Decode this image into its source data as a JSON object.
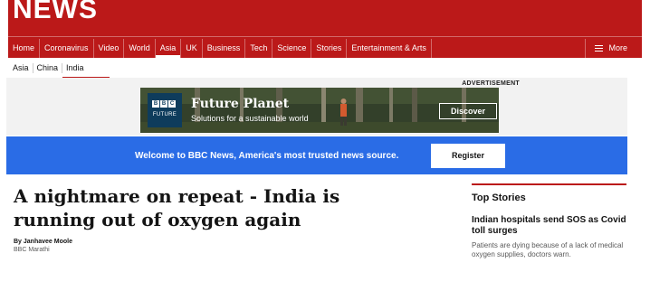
{
  "header": {
    "logo": "NEWS",
    "nav": [
      "Home",
      "Coronavirus",
      "Video",
      "World",
      "Asia",
      "UK",
      "Business",
      "Tech",
      "Science",
      "Stories",
      "Entertainment & Arts"
    ],
    "active_nav": "Asia",
    "more_label": "More"
  },
  "subnav": {
    "items": [
      "Asia",
      "China",
      "India"
    ],
    "active": "India"
  },
  "ad": {
    "label": "ADVERTISEMENT",
    "logo_letters": [
      "B",
      "B",
      "C"
    ],
    "logo_word": "FUTURE",
    "title": "Future Planet",
    "subtitle": "Solutions for a sustainable world",
    "button": "Discover"
  },
  "banner": {
    "text": "Welcome to BBC News, America's most trusted news source.",
    "button": "Register"
  },
  "article": {
    "headline": "A nightmare on repeat - India is running out of oxygen again",
    "byline": "By Janhavee Moole",
    "org": "BBC Marathi"
  },
  "top_stories": {
    "heading": "Top Stories",
    "items": [
      {
        "title": "Indian hospitals send SOS as Covid toll surges",
        "summary": "Patients are dying because of a lack of medical oxygen supplies, doctors warn."
      }
    ]
  },
  "colors": {
    "brand_red": "#bb1919",
    "banner_blue": "#2a6ce6",
    "ad_logo_blue": "#0e3c5c"
  }
}
